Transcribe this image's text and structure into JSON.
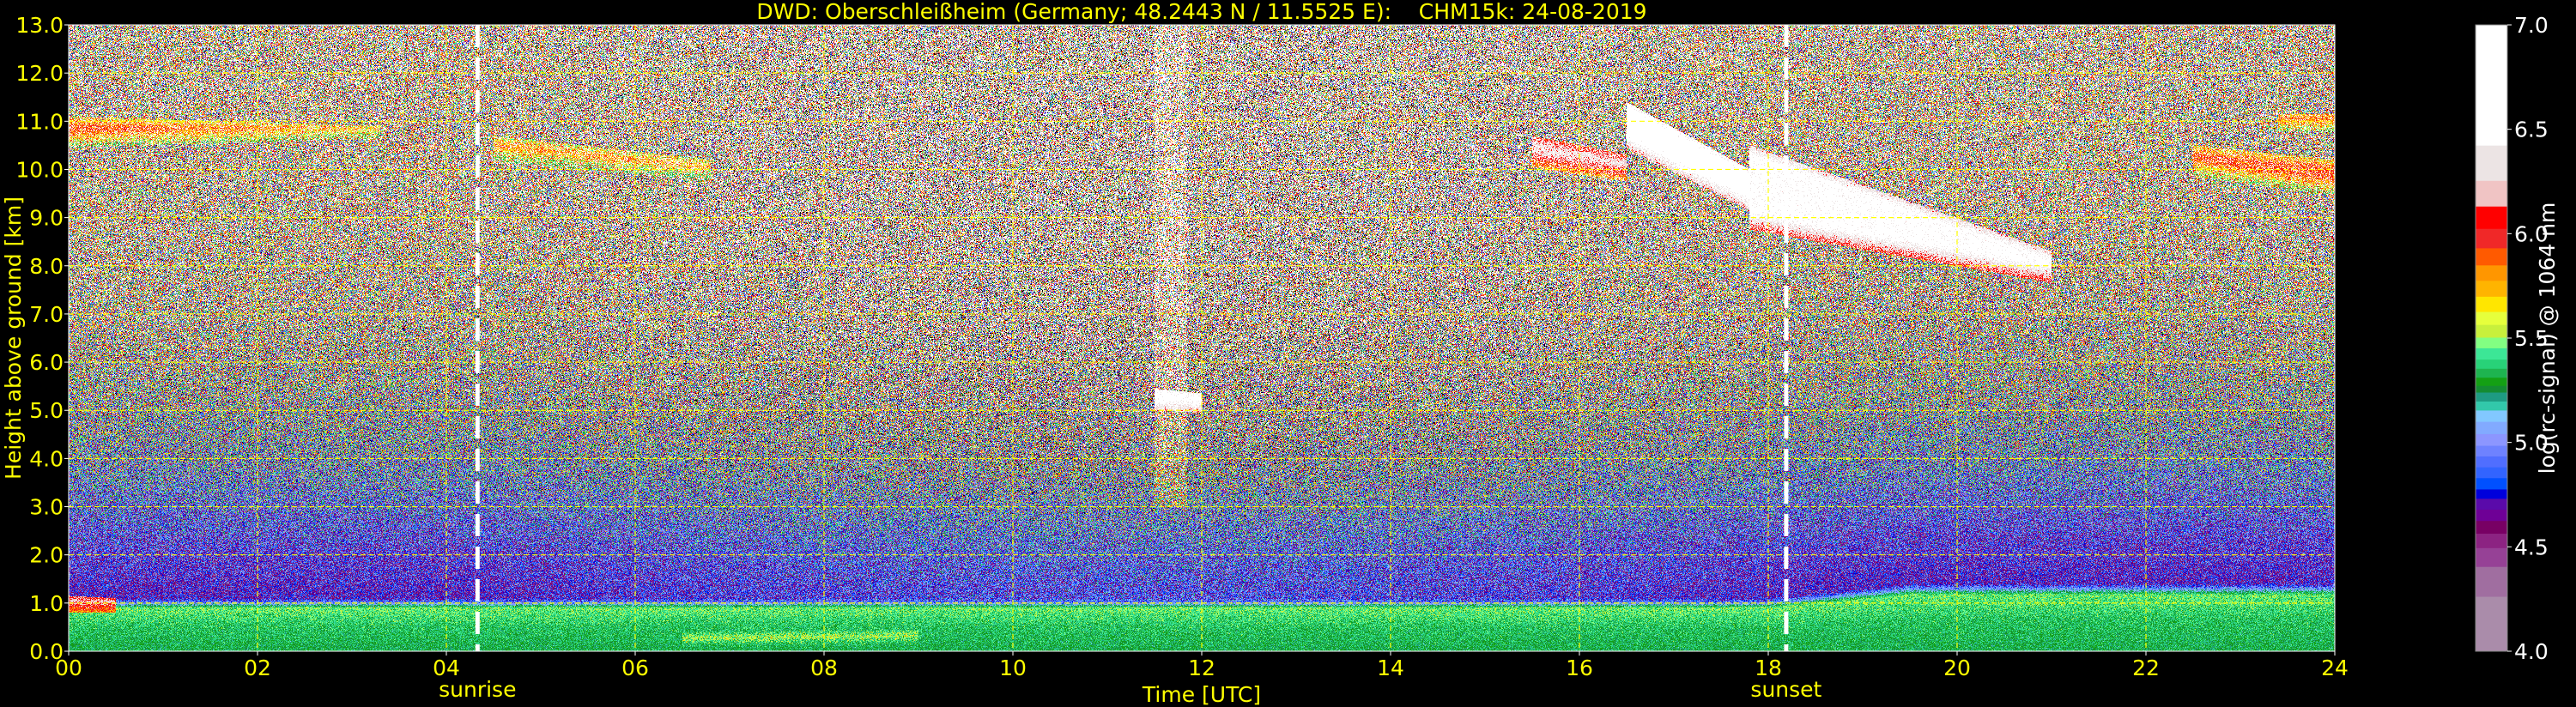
{
  "chart_data": {
    "type": "heatmap",
    "title": "DWD: Oberschleißheim (Germany; 48.2443 N / 11.5525 E):    CHM15k: 24-08-2019",
    "xlabel": "Time [UTC]",
    "ylabel": "Height above ground [km]",
    "xlim": [
      0,
      24
    ],
    "ylim": [
      0,
      13
    ],
    "x_ticks": [
      "00",
      "02",
      "04",
      "06",
      "08",
      "10",
      "12",
      "14",
      "16",
      "18",
      "20",
      "22",
      "24"
    ],
    "x_tick_values": [
      0,
      2,
      4,
      6,
      8,
      10,
      12,
      14,
      16,
      18,
      20,
      22,
      24
    ],
    "y_ticks": [
      "0.0",
      "1.0",
      "2.0",
      "3.0",
      "4.0",
      "5.0",
      "6.0",
      "7.0",
      "8.0",
      "9.0",
      "10.0",
      "11.0",
      "12.0",
      "13.0"
    ],
    "y_tick_values": [
      0,
      1,
      2,
      3,
      4,
      5,
      6,
      7,
      8,
      9,
      10,
      11,
      12,
      13
    ],
    "grid": true,
    "grid_color": "#ffff00",
    "text_color": "#ffff00",
    "markers": [
      {
        "label": "sunrise",
        "time": 4.33
      },
      {
        "label": "sunset",
        "time": 18.19
      }
    ],
    "background_profile": [
      {
        "height": 0.0,
        "value": 5.3,
        "spread": 0.06
      },
      {
        "height": 0.5,
        "value": 5.35,
        "spread": 0.07
      },
      {
        "height": 0.9,
        "value": 5.45,
        "spread": 0.08
      },
      {
        "height": 1.0,
        "value": 5.0,
        "spread": 0.12
      },
      {
        "height": 1.1,
        "value": 4.7,
        "spread": 0.15
      },
      {
        "height": 2.0,
        "value": 4.75,
        "spread": 0.22
      },
      {
        "height": 3.0,
        "value": 4.85,
        "spread": 0.35
      },
      {
        "height": 4.0,
        "value": 5.0,
        "spread": 0.5
      },
      {
        "height": 5.0,
        "value": 5.2,
        "spread": 0.6
      },
      {
        "height": 6.0,
        "value": 5.35,
        "spread": 0.7
      },
      {
        "height": 7.0,
        "value": 5.5,
        "spread": 0.75
      },
      {
        "height": 9.0,
        "value": 5.65,
        "spread": 0.8
      },
      {
        "height": 13.0,
        "value": 5.75,
        "spread": 0.85
      }
    ],
    "features": [
      {
        "t0": 0.0,
        "t1": 3.3,
        "top0": 11.1,
        "top1": 10.9,
        "bot0": 10.6,
        "bot1": 10.8,
        "value": 5.9
      },
      {
        "t0": 4.5,
        "t1": 6.8,
        "top0": 10.7,
        "top1": 10.2,
        "bot0": 10.3,
        "bot1": 9.9,
        "value": 5.8
      },
      {
        "t0": 11.5,
        "t1": 12.0,
        "top0": 5.45,
        "top1": 5.35,
        "bot0": 5.15,
        "bot1": 5.1,
        "value": 6.8
      },
      {
        "t0": 15.5,
        "t1": 16.5,
        "top0": 10.7,
        "top1": 10.3,
        "bot0": 10.2,
        "bot1": 9.9,
        "value": 6.3
      },
      {
        "t0": 16.5,
        "t1": 17.8,
        "top0": 11.4,
        "top1": 10.0,
        "bot0": 10.6,
        "bot1": 9.3,
        "value": 6.8
      },
      {
        "t0": 17.8,
        "t1": 21.0,
        "top0": 10.5,
        "top1": 8.3,
        "bot0": 8.9,
        "bot1": 7.8,
        "value": 6.6
      },
      {
        "t0": 22.5,
        "t1": 24.0,
        "top0": 10.5,
        "top1": 10.2,
        "bot0": 10.0,
        "bot1": 9.6,
        "value": 5.9
      },
      {
        "t0": 23.4,
        "t1": 24.0,
        "top0": 11.15,
        "top1": 11.15,
        "bot0": 10.95,
        "bot1": 10.95,
        "value": 6.0
      },
      {
        "t0": 0.0,
        "t1": 0.5,
        "top0": 1.15,
        "top1": 1.1,
        "bot0": 0.95,
        "bot1": 0.95,
        "value": 6.4
      },
      {
        "t0": 6.5,
        "t1": 9.0,
        "top0": 0.4,
        "top1": 0.45,
        "bot0": 0.15,
        "bot1": 0.2,
        "value": 5.65
      }
    ],
    "colorbar": {
      "label": "log(rc-signal) @ 1064 nm",
      "range": [
        4.0,
        7.0
      ],
      "ticks": [
        "4.0",
        "4.5",
        "5.0",
        "5.5",
        "6.0",
        "6.5",
        "7.0"
      ],
      "tick_values": [
        4.0,
        4.5,
        5.0,
        5.5,
        6.0,
        6.5,
        7.0
      ],
      "levels": [
        4.0,
        4.263,
        4.406,
        4.496,
        4.565,
        4.626,
        4.68,
        4.732,
        4.777,
        4.831,
        4.883,
        4.935,
        4.986,
        5.042,
        5.101,
        5.155,
        5.198,
        5.241,
        5.273,
        5.312,
        5.355,
        5.399,
        5.453,
        5.504,
        5.565,
        5.627,
        5.7,
        5.776,
        5.85,
        5.932,
        6.025,
        6.132,
        6.255,
        6.424,
        7.0
      ],
      "colors": [
        "#aa8caa",
        "#a06ea0",
        "#964196",
        "#8c2382",
        "#780064",
        "#6e0096",
        "#5a0aaa",
        "#0000dc",
        "#0050ff",
        "#3264ff",
        "#506eff",
        "#6e82ff",
        "#8c96ff",
        "#82aaff",
        "#82c8ff",
        "#32c8aa",
        "#1e9b82",
        "#148c32",
        "#14a014",
        "#1eb450",
        "#28d278",
        "#3ce696",
        "#82ff82",
        "#c8f03c",
        "#e6ff3c",
        "#ffe600",
        "#ffb400",
        "#ff9600",
        "#ff5a00",
        "#f02828",
        "#ff0000",
        "#f0c4c4",
        "#ece4e4",
        "#ffffff"
      ],
      "under_color": "#000000",
      "over_color": "#ffffff"
    }
  }
}
